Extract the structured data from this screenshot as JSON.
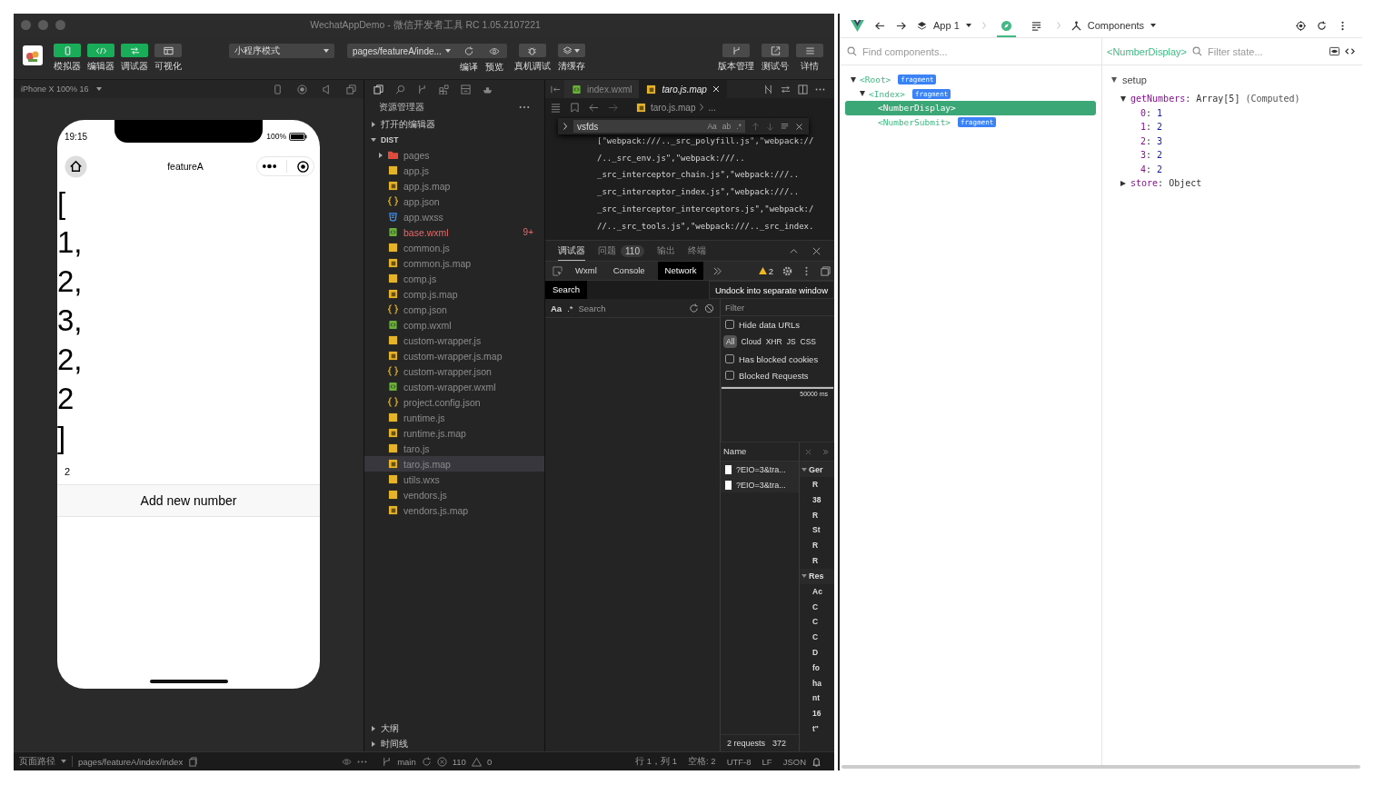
{
  "window": {
    "title": "WechatAppDemo - 微信开发者工具 RC 1.05.2107221"
  },
  "toolbar": {
    "view_buttons": [
      {
        "label": "模拟器",
        "on": true,
        "kind": "phone"
      },
      {
        "label": "编辑器",
        "on": true,
        "kind": "code"
      },
      {
        "label": "调试器",
        "on": true,
        "kind": "debug"
      },
      {
        "label": "可视化",
        "on": false,
        "kind": "layout"
      }
    ],
    "mode_select": {
      "value": "小程序模式"
    },
    "compile_select": {
      "value": "pages/featureA/inde..."
    },
    "compile_labels": [
      "编译",
      "预览"
    ],
    "tools": [
      {
        "label": "真机调试",
        "kind": "bug",
        "dropdown": false
      },
      {
        "label": "清缓存",
        "kind": "layers",
        "dropdown": true
      }
    ],
    "right_buttons": [
      {
        "label": "版本管理",
        "kind": "branch"
      },
      {
        "label": "测试号",
        "kind": "share"
      },
      {
        "label": "详情",
        "kind": "menu"
      }
    ]
  },
  "simulator": {
    "device": "iPhone X 100% 16",
    "phone": {
      "time": "19:15",
      "battery": "100%",
      "nav_title": "featureA",
      "lines": [
        "[",
        "1,",
        "2,",
        "3,",
        "2,",
        "2",
        "]"
      ],
      "count": "2",
      "button": "Add new number"
    }
  },
  "explorer": {
    "title": "资源管理器",
    "sections": [
      {
        "label": "打开的编辑器",
        "expanded": false
      }
    ],
    "root": {
      "label": "DIST",
      "expanded": true,
      "children": [
        {
          "name": "pages",
          "kind": "folder",
          "expanded": false,
          "selected": false,
          "error": false
        },
        {
          "name": "app.js",
          "kind": "js",
          "selected": false,
          "error": false
        },
        {
          "name": "app.js.map",
          "kind": "map",
          "selected": false,
          "error": false
        },
        {
          "name": "app.json",
          "kind": "json",
          "selected": false,
          "error": false
        },
        {
          "name": "app.wxss",
          "kind": "wxss",
          "selected": false,
          "error": false
        },
        {
          "name": "base.wxml",
          "kind": "wxml",
          "selected": false,
          "error": true,
          "badge": "9+"
        },
        {
          "name": "common.js",
          "kind": "js",
          "selected": false,
          "error": false
        },
        {
          "name": "common.js.map",
          "kind": "map",
          "selected": false,
          "error": false
        },
        {
          "name": "comp.js",
          "kind": "js",
          "selected": false,
          "error": false
        },
        {
          "name": "comp.js.map",
          "kind": "map",
          "selected": false,
          "error": false
        },
        {
          "name": "comp.json",
          "kind": "json",
          "selected": false,
          "error": false
        },
        {
          "name": "comp.wxml",
          "kind": "wxml",
          "selected": false,
          "error": false
        },
        {
          "name": "custom-wrapper.js",
          "kind": "js",
          "selected": false,
          "error": false
        },
        {
          "name": "custom-wrapper.js.map",
          "kind": "map",
          "selected": false,
          "error": false
        },
        {
          "name": "custom-wrapper.json",
          "kind": "json",
          "selected": false,
          "error": false
        },
        {
          "name": "custom-wrapper.wxml",
          "kind": "wxml",
          "selected": false,
          "error": false
        },
        {
          "name": "project.config.json",
          "kind": "json",
          "selected": false,
          "error": false
        },
        {
          "name": "runtime.js",
          "kind": "js",
          "selected": false,
          "error": false
        },
        {
          "name": "runtime.js.map",
          "kind": "map",
          "selected": false,
          "error": false
        },
        {
          "name": "taro.js",
          "kind": "js",
          "selected": false,
          "error": false
        },
        {
          "name": "taro.js.map",
          "kind": "map",
          "selected": true,
          "error": false
        },
        {
          "name": "utils.wxs",
          "kind": "js",
          "selected": false,
          "error": false
        },
        {
          "name": "vendors.js",
          "kind": "js",
          "selected": false,
          "error": false
        },
        {
          "name": "vendors.js.map",
          "kind": "map",
          "selected": false,
          "error": false
        }
      ]
    },
    "bottom_sections": [
      {
        "label": "大纲",
        "expanded": false
      },
      {
        "label": "时间线",
        "expanded": false
      }
    ]
  },
  "editor": {
    "tabs": [
      {
        "label": "index.wxml",
        "kind": "wxml",
        "selected": false
      },
      {
        "label": "taro.js.map",
        "kind": "map",
        "selected": true
      }
    ],
    "breadcrumb": {
      "file": "taro.js.map",
      "rest": "..."
    },
    "find": {
      "value": "vsfds",
      "options": [
        "Aa",
        "ab",
        ".*"
      ]
    },
    "code_lines": [
      "[\"webpack:///.._src_polyfill.js\",\"webpack://",
      "/.._src_env.js\",\"webpack:///..",
      "_src_interceptor_chain.js\",\"webpack:///..",
      "_src_interceptor_index.js\",\"webpack:///..",
      "_src_interceptor_interceptors.js\",\"webpack:/",
      "//.._src_tools.js\",\"webpack:///.._src_index."
    ]
  },
  "debugger": {
    "tabs": [
      {
        "label": "调试器",
        "selected": true
      },
      {
        "label": "问题",
        "selected": false,
        "count": "110"
      },
      {
        "label": "输出",
        "selected": false
      },
      {
        "label": "终端",
        "selected": false
      }
    ],
    "devtools_tabs": [
      {
        "label": "Wxml",
        "selected": false
      },
      {
        "label": "Console",
        "selected": false
      },
      {
        "label": "Network",
        "selected": true
      }
    ],
    "warnings": "2",
    "drawer_tab": "Search",
    "tooltip": "Undock into separate window",
    "search": {
      "case_toggle": "Aa",
      "regex_toggle": ".*",
      "placeholder": "Search"
    },
    "network": {
      "filter_placeholder": "Filter",
      "filters": [
        {
          "kind": "checkbox",
          "label": "Hide data URLs",
          "checked": false
        },
        {
          "kind": "types",
          "types": [
            {
              "label": "All",
              "selected": true
            },
            {
              "label": "Cloud",
              "selected": false
            },
            {
              "label": "XHR",
              "selected": false
            },
            {
              "label": "JS",
              "selected": false
            },
            {
              "label": "CSS",
              "selected": false
            }
          ]
        },
        {
          "kind": "checkbox",
          "label": "Has blocked cookies",
          "checked": false
        },
        {
          "kind": "checkbox",
          "label": "Blocked Requests",
          "checked": false
        }
      ],
      "overview_label": "50000 ms",
      "name_header": "Name",
      "requests": [
        "?EIO=3&tra...",
        "?EIO=3&tra..."
      ],
      "details": [
        {
          "label": "Ger",
          "expanded": true,
          "lines": [
            "R",
            "38",
            "R",
            "St",
            "R",
            "R"
          ]
        },
        {
          "label": "Res",
          "expanded": true,
          "lines": [
            "Ac",
            "C",
            "C",
            "C",
            "D",
            "fo",
            "ha",
            "nt",
            "16",
            "t\""
          ]
        }
      ],
      "footer": [
        "2 requests",
        "372"
      ]
    }
  },
  "status_bar": {
    "path_label": "页面路径",
    "path": "pages/featureA/index/index",
    "branch": "main",
    "errors": "110",
    "warnings": "0",
    "position": "行 1，列 1",
    "indent": "空格: 2",
    "encoding": "UTF-8",
    "eol": "LF",
    "language": "JSON"
  },
  "vue_devtools": {
    "app": "App 1",
    "view": "Components",
    "tools": [
      {
        "kind": "inspector",
        "selected": true
      },
      {
        "kind": "timeline",
        "selected": false
      }
    ],
    "search_placeholder": "Find components...",
    "tree": [
      {
        "name": "<Root>",
        "tag": "fragment",
        "expanded": true,
        "selected": false,
        "children": [
          {
            "name": "<Index>",
            "tag": "fragment",
            "expanded": true,
            "selected": false,
            "children": [
              {
                "name": "<NumberDisplay>",
                "selected": true
              },
              {
                "name": "<NumberSubmit>",
                "tag": "fragment",
                "selected": false
              }
            ]
          }
        ]
      }
    ],
    "inspector": {
      "component": "<NumberDisplay>",
      "filter_placeholder": "Filter state...",
      "separator": ":",
      "sections": [
        {
          "name": "setup",
          "expanded": true,
          "props": [
            {
              "key": "getNumbers",
              "value": "Array[5]",
              "note": "(Computed)",
              "expanded": true,
              "items": [
                {
                  "key": "0",
                  "value": "1"
                },
                {
                  "key": "1",
                  "value": "2"
                },
                {
                  "key": "2",
                  "value": "3"
                },
                {
                  "key": "3",
                  "value": "2"
                },
                {
                  "key": "4",
                  "value": "2"
                }
              ]
            },
            {
              "key": "store",
              "value": "Object",
              "expanded": false
            }
          ]
        }
      ]
    }
  }
}
